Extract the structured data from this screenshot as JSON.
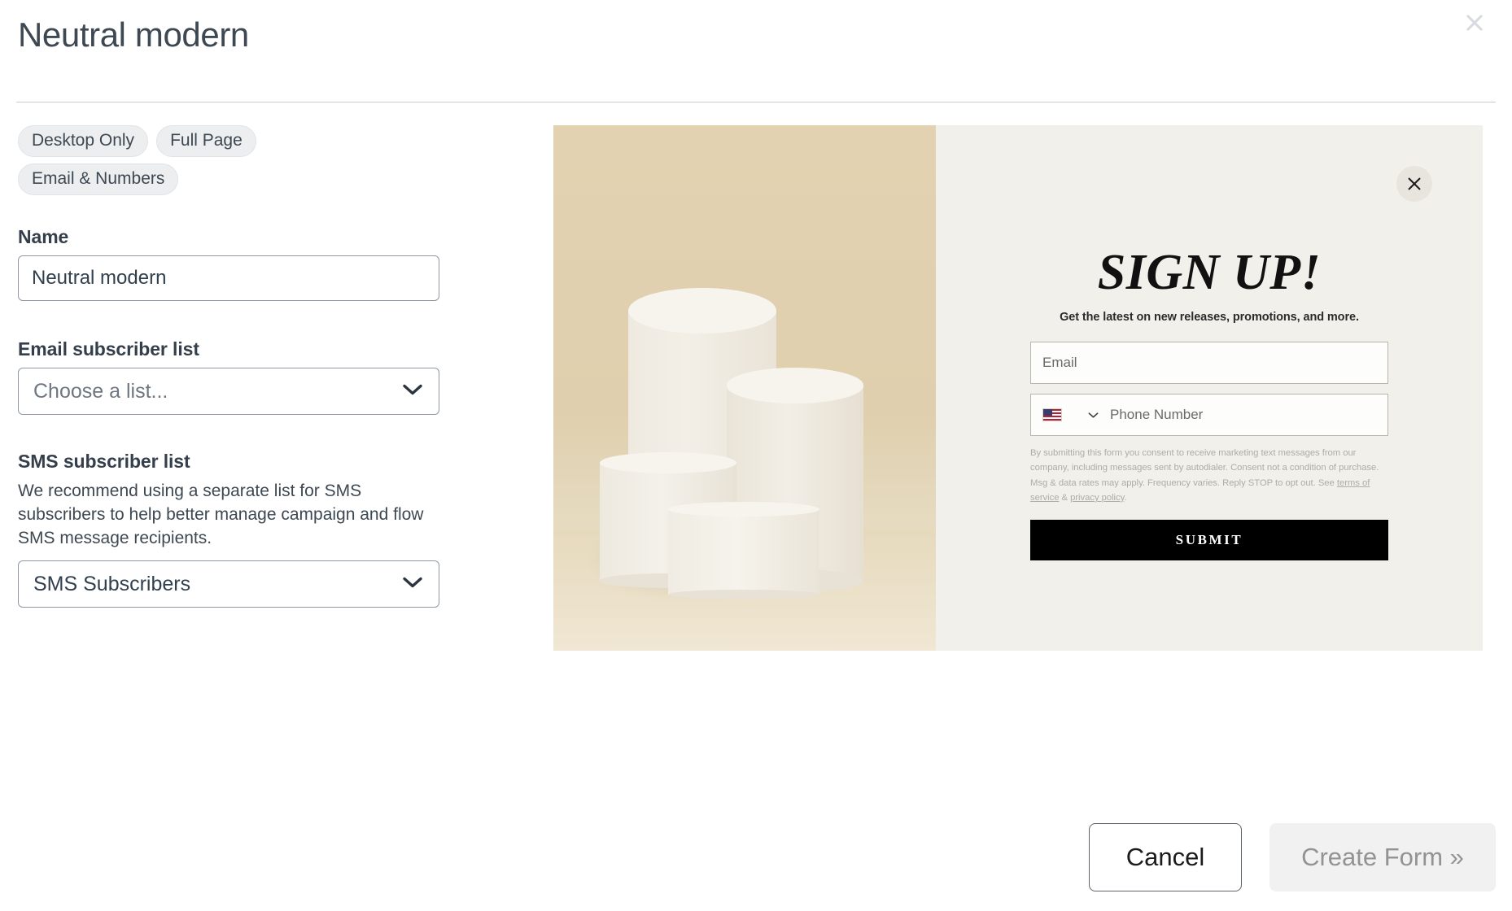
{
  "modal": {
    "title": "Neutral modern",
    "close_icon": "close-icon"
  },
  "tags": [
    {
      "label": "Desktop Only"
    },
    {
      "label": "Full Page"
    },
    {
      "label": "Email & Numbers"
    }
  ],
  "form": {
    "name": {
      "label": "Name",
      "value": "Neutral modern",
      "placeholder": "Name"
    },
    "email_list": {
      "label": "Email subscriber list",
      "value": "Choose a list...",
      "is_placeholder": true
    },
    "sms_list": {
      "label": "SMS subscriber list",
      "help": "We recommend using a separate list for SMS subscribers to help better manage campaign and flow SMS message recipients.",
      "value": "SMS Subscribers",
      "is_placeholder": false
    }
  },
  "preview": {
    "close_icon": "close-icon",
    "heading": "SIGN UP!",
    "subheading": "Get the latest on new releases, promotions, and more.",
    "email_placeholder": "Email",
    "phone_placeholder": "Phone Number",
    "country_flag": "us-flag-icon",
    "consent_text_1": "By submitting this form you consent to receive marketing text messages from our company, including messages sent by autodialer. Consent not a condition of purchase. Msg & data rates may apply. Frequency varies. Reply STOP to opt out. See ",
    "consent_link_1": "terms of service",
    "consent_text_2": " & ",
    "consent_link_2": "privacy policy",
    "consent_text_3": ".",
    "submit_label": "SUBMIT"
  },
  "footer": {
    "cancel_label": "Cancel",
    "create_label": "Create Form »"
  },
  "colors": {
    "image_background": "#dfcfae",
    "panel_background": "#f2f0eb",
    "submit_background": "#000000",
    "tag_background": "#eceef0",
    "text_primary": "#32404e"
  }
}
